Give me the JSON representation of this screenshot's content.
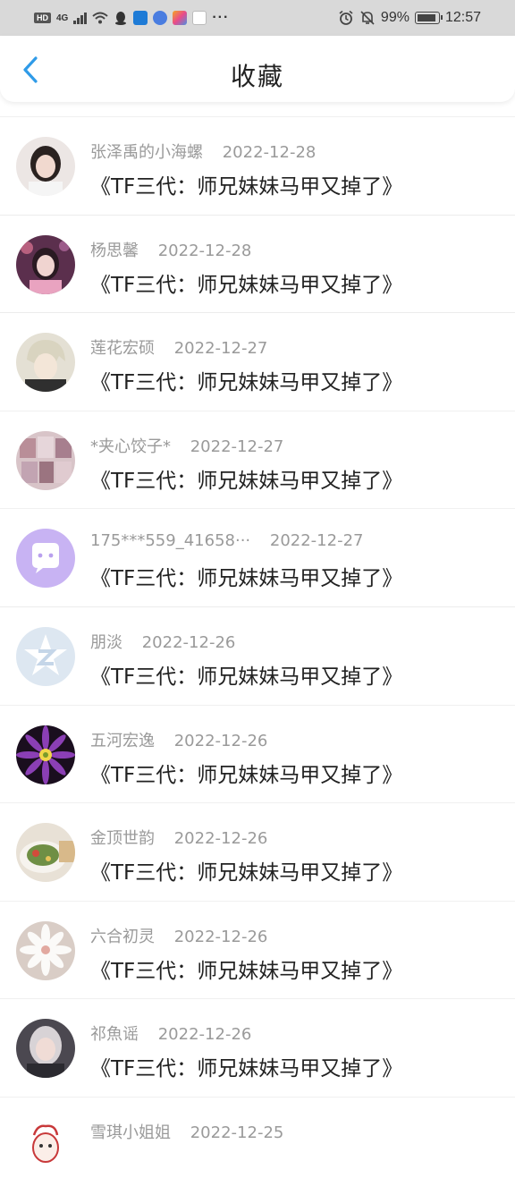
{
  "status_bar": {
    "hd": "HD",
    "network": "4G",
    "battery": "99%",
    "time": "12:57",
    "more": "···"
  },
  "header": {
    "title": "收藏"
  },
  "items": [
    {
      "name": "张泽禹的小海螺",
      "date": "2022-12-28",
      "title": "《TF三代：师兄妹妹马甲又掉了》",
      "avatar_color": "#d8c8c0"
    },
    {
      "name": "杨思馨",
      "date": "2022-12-28",
      "title": "《TF三代：师兄妹妹马甲又掉了》",
      "avatar_color": "#6b3a5a"
    },
    {
      "name": "莲花宏硕",
      "date": "2022-12-27",
      "title": "《TF三代：师兄妹妹马甲又掉了》",
      "avatar_color": "#cfcbb8"
    },
    {
      "name": "*夹心饺子*",
      "date": "2022-12-27",
      "title": "《TF三代：师兄妹妹马甲又掉了》",
      "avatar_color": "#c9a9b0"
    },
    {
      "name": "175***559_41658···",
      "date": "2022-12-27",
      "title": "《TF三代：师兄妹妹马甲又掉了》",
      "avatar_color": "#c9b3f0"
    },
    {
      "name": "朋淡",
      "date": "2022-12-26",
      "title": "《TF三代：师兄妹妹马甲又掉了》",
      "avatar_color": "#dfe8f2"
    },
    {
      "name": "五河宏逸",
      "date": "2022-12-26",
      "title": "《TF三代：师兄妹妹马甲又掉了》",
      "avatar_color": "#5a1f6e"
    },
    {
      "name": "金顶世韵",
      "date": "2022-12-26",
      "title": "《TF三代：师兄妹妹马甲又掉了》",
      "avatar_color": "#9fae7e"
    },
    {
      "name": "六合初灵",
      "date": "2022-12-26",
      "title": "《TF三代：师兄妹妹马甲又掉了》",
      "avatar_color": "#e9e3de"
    },
    {
      "name": "祁魚谣",
      "date": "2022-12-26",
      "title": "《TF三代：师兄妹妹马甲又掉了》",
      "avatar_color": "#5e5a5f"
    },
    {
      "name": "雪琪小姐姐",
      "date": "2022-12-25",
      "title": "",
      "avatar_color": "#f3e8e4"
    }
  ]
}
